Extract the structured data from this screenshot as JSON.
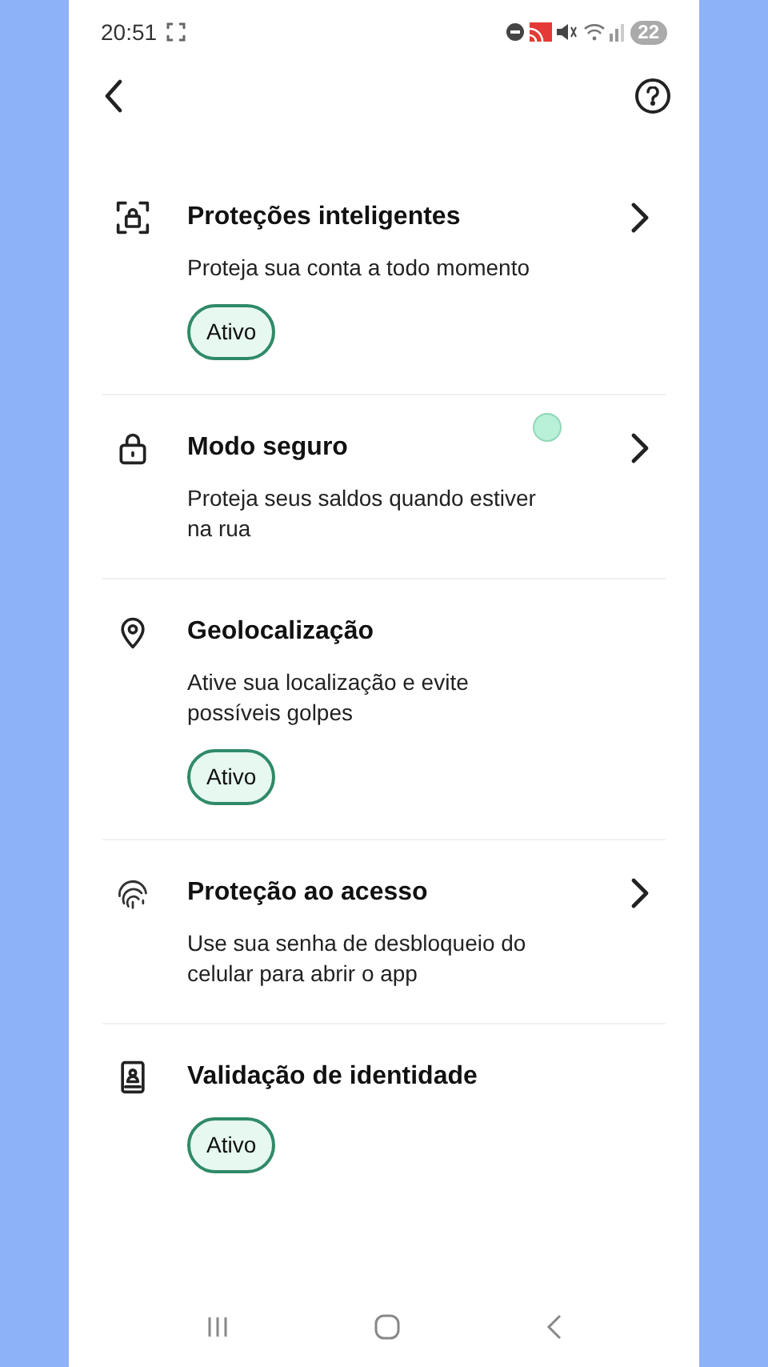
{
  "status_bar": {
    "time": "20:51",
    "battery": "22"
  },
  "items": [
    {
      "title": "Proteções inteligentes",
      "description": "Proteja sua conta a todo momento",
      "chevron": true,
      "status": "Ativo"
    },
    {
      "title": "Modo seguro",
      "description": "Proteja seus saldos quando estiver na rua",
      "chevron": true
    },
    {
      "title": "Geolocalização",
      "description": "Ative sua localização e evite possíveis golpes",
      "chevron": false,
      "status": "Ativo"
    },
    {
      "title": "Proteção ao acesso",
      "description": "Use sua senha de desbloqueio do celular para abrir o app",
      "chevron": true
    },
    {
      "title": "Validação de identidade",
      "chevron": false,
      "status": "Ativo"
    }
  ]
}
